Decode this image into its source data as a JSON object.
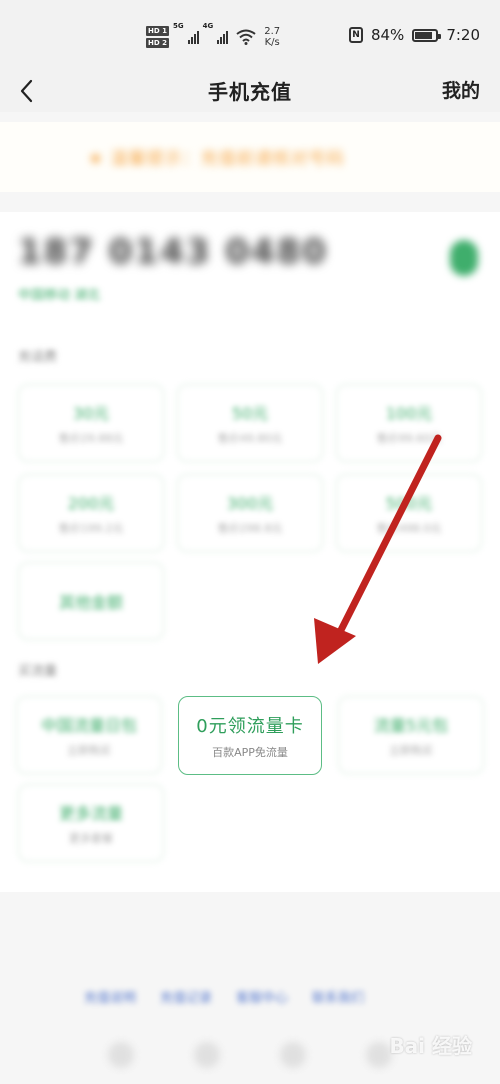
{
  "status_bar": {
    "hd1": "HD 1",
    "hd2": "HD 2",
    "net1": "5G",
    "net2": "4G",
    "speed_value": "2.7",
    "speed_unit": "K/s",
    "nfc": "N",
    "battery_percent_text": "84%",
    "battery_level": 0.84,
    "time": "7:20"
  },
  "header": {
    "title": "手机充值",
    "right_link": "我的"
  },
  "notice": {
    "text": "★ 温馨提示：充值前请核对号码"
  },
  "account": {
    "phone": "187 0143 0480",
    "carrier": "中国移动 湖北"
  },
  "sections": {
    "recharge_label": "充话费",
    "flow_label": "买流量"
  },
  "recharge_tiles": [
    {
      "main": "30元",
      "sub": "售价29.88元"
    },
    {
      "main": "50元",
      "sub": "售价49.80元"
    },
    {
      "main": "100元",
      "sub": "售价99.60元"
    },
    {
      "main": "200元",
      "sub": "售价199.2元"
    },
    {
      "main": "300元",
      "sub": "售价298.8元"
    },
    {
      "main": "500元",
      "sub": "售价498.0元"
    },
    {
      "main": "其他金额",
      "sub": ""
    }
  ],
  "flow_tiles": [
    {
      "main": "中国流量日包",
      "sub": "立即购买"
    },
    {
      "main": "0元领流量卡",
      "sub": "百款APP免流量",
      "featured": true
    },
    {
      "main": "流量5元包",
      "sub": "立即购买"
    },
    {
      "main": "更多流量",
      "sub": "更多套餐"
    }
  ],
  "footer": {
    "links": [
      "充值说明",
      "充值记录",
      "客服中心",
      "联系我们"
    ]
  },
  "watermark": "Bai 经验",
  "colors": {
    "accent_green": "#3fae6c",
    "notice_orange": "#f6a94a",
    "arrow_red": "#c0231f"
  }
}
